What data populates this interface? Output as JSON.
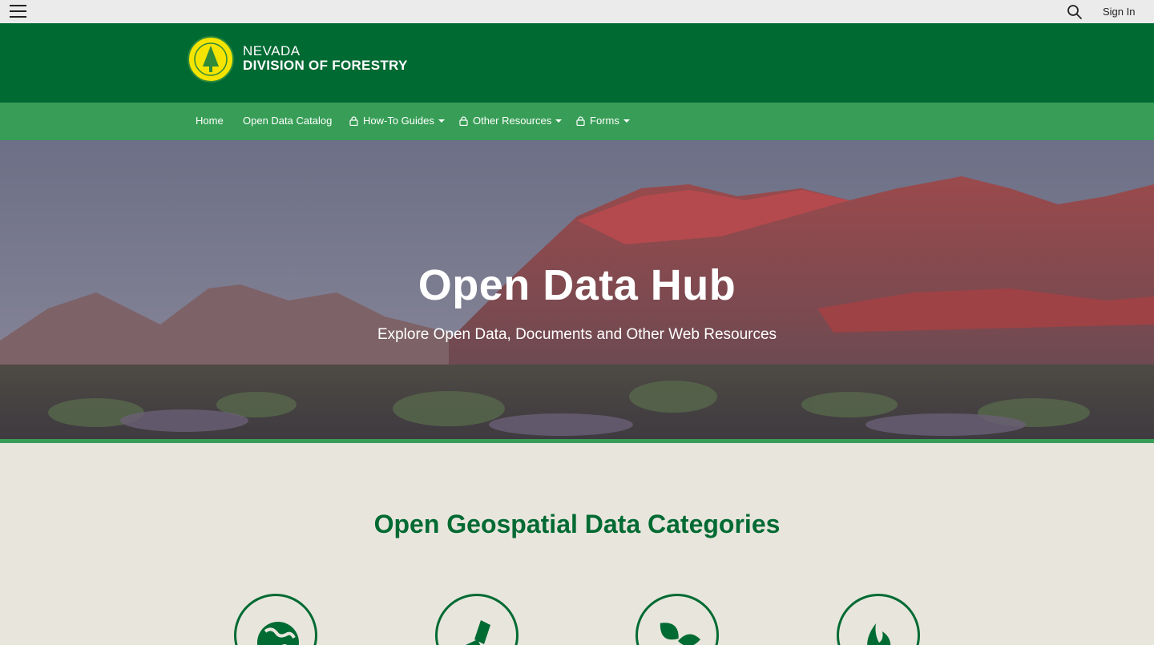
{
  "topbar": {
    "menu_icon": "hamburger-menu-icon",
    "search_icon": "search-icon",
    "signin_label": "Sign In"
  },
  "header": {
    "logo_text": "NEVADA DIVISION OF FORESTRY",
    "brand_line1": "NEVADA",
    "brand_line2": "DIVISION OF FORESTRY"
  },
  "nav": {
    "items": [
      {
        "label": "Home",
        "locked": false,
        "dropdown": false
      },
      {
        "label": "Open Data Catalog",
        "locked": false,
        "dropdown": false
      },
      {
        "label": "How-To Guides",
        "locked": true,
        "dropdown": true
      },
      {
        "label": "Other Resources",
        "locked": true,
        "dropdown": true
      },
      {
        "label": "Forms",
        "locked": true,
        "dropdown": true
      }
    ]
  },
  "hero": {
    "title": "Open Data Hub",
    "subtitle": "Explore Open Data, Documents and Other Web Resources"
  },
  "categories": {
    "title": "Open Geospatial Data Categories",
    "icons": [
      "globe-icon",
      "torch-icon",
      "leaves-icon",
      "flame-icon"
    ]
  },
  "colors": {
    "header_green": "#006a33",
    "nav_green": "#389e57",
    "page_background": "#e8e6dc",
    "topbar_background": "#ebebeb"
  }
}
